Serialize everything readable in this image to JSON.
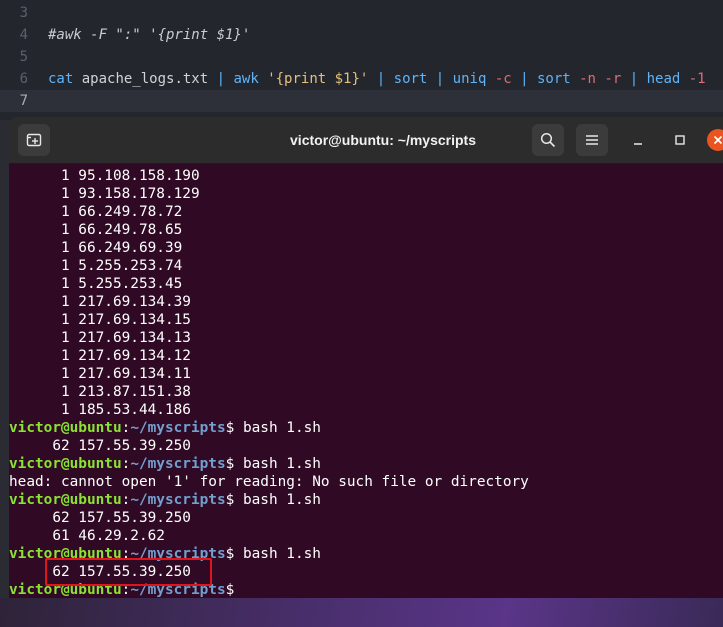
{
  "editor": {
    "lines": [
      {
        "num": "3",
        "text": ""
      },
      {
        "num": "4",
        "text": "#awk -F \":\" '{print $1}'"
      },
      {
        "num": "5",
        "text": ""
      },
      {
        "num": "6",
        "tokens": [
          {
            "t": "cat",
            "k": "cmd"
          },
          {
            "t": " apache_logs.txt ",
            "k": "plain"
          },
          {
            "t": "|",
            "k": "pipe"
          },
          {
            "t": " awk ",
            "k": "cmd"
          },
          {
            "t": "'{print $1}'",
            "k": "str"
          },
          {
            "t": " ",
            "k": "plain"
          },
          {
            "t": "|",
            "k": "pipe"
          },
          {
            "t": " sort ",
            "k": "cmd"
          },
          {
            "t": "|",
            "k": "pipe"
          },
          {
            "t": " uniq ",
            "k": "cmd"
          },
          {
            "t": "-c",
            "k": "flag"
          },
          {
            "t": " ",
            "k": "plain"
          },
          {
            "t": "|",
            "k": "pipe"
          },
          {
            "t": " sort ",
            "k": "cmd"
          },
          {
            "t": "-n",
            "k": "flag"
          },
          {
            "t": " ",
            "k": "plain"
          },
          {
            "t": "-r",
            "k": "flag"
          },
          {
            "t": " ",
            "k": "plain"
          },
          {
            "t": "|",
            "k": "pipe"
          },
          {
            "t": " head ",
            "k": "cmd"
          },
          {
            "t": "-1",
            "k": "flag"
          }
        ]
      },
      {
        "num": "7",
        "text": "",
        "current": true
      }
    ]
  },
  "terminal": {
    "title": "victor@ubuntu: ~/myscripts",
    "prompt": {
      "user": "victor@ubuntu",
      "sep": ":",
      "path": "~/myscripts",
      "dollar": "$"
    },
    "lines": [
      {
        "type": "out",
        "text": "      1 95.108.158.190"
      },
      {
        "type": "out",
        "text": "      1 93.158.178.129"
      },
      {
        "type": "out",
        "text": "      1 66.249.78.72"
      },
      {
        "type": "out",
        "text": "      1 66.249.78.65"
      },
      {
        "type": "out",
        "text": "      1 66.249.69.39"
      },
      {
        "type": "out",
        "text": "      1 5.255.253.74"
      },
      {
        "type": "out",
        "text": "      1 5.255.253.45"
      },
      {
        "type": "out",
        "text": "      1 217.69.134.39"
      },
      {
        "type": "out",
        "text": "      1 217.69.134.15"
      },
      {
        "type": "out",
        "text": "      1 217.69.134.13"
      },
      {
        "type": "out",
        "text": "      1 217.69.134.12"
      },
      {
        "type": "out",
        "text": "      1 217.69.134.11"
      },
      {
        "type": "out",
        "text": "      1 213.87.151.38"
      },
      {
        "type": "out",
        "text": "      1 185.53.44.186"
      },
      {
        "type": "prompt",
        "cmd": " bash 1.sh"
      },
      {
        "type": "out",
        "text": "     62 157.55.39.250"
      },
      {
        "type": "prompt",
        "cmd": " bash 1.sh"
      },
      {
        "type": "out",
        "text": "head: cannot open '1' for reading: No such file or directory"
      },
      {
        "type": "prompt",
        "cmd": " bash 1.sh"
      },
      {
        "type": "out",
        "text": "     62 157.55.39.250"
      },
      {
        "type": "out",
        "text": "     61 46.29.2.62"
      },
      {
        "type": "prompt",
        "cmd": " bash 1.sh"
      },
      {
        "type": "out",
        "text": "     62 157.55.39.250",
        "highlight": true
      },
      {
        "type": "prompt",
        "cmd": ""
      }
    ]
  },
  "icons": {
    "newtab": "new-tab-icon",
    "search": "search-icon",
    "menu": "hamburger-menu-icon",
    "minimize": "minimize-icon",
    "maximize": "maximize-icon",
    "close": "close-icon"
  },
  "colors": {
    "terminal_bg": "#300a24",
    "prompt_user": "#8ae234",
    "prompt_path": "#729fcf",
    "highlight_border": "#e0141b",
    "close_button": "#e95420"
  }
}
